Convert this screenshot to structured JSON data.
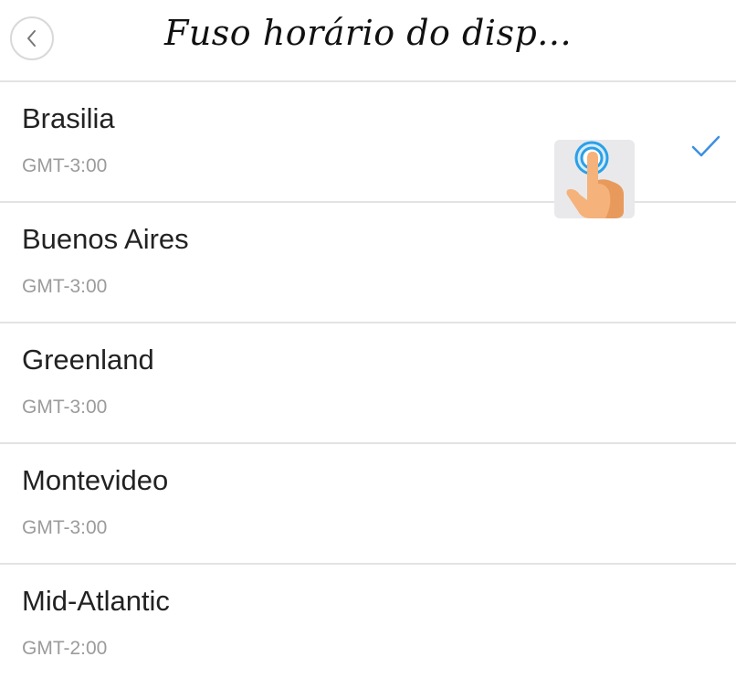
{
  "header": {
    "title": "Fuso horário do disp...",
    "back_icon": "chevron-left-icon"
  },
  "timezones": [
    {
      "name": "Brasilia",
      "offset": "GMT-3:00",
      "selected": true
    },
    {
      "name": "Buenos Aires",
      "offset": "GMT-3:00",
      "selected": false
    },
    {
      "name": "Greenland",
      "offset": "GMT-3:00",
      "selected": false
    },
    {
      "name": "Montevideo",
      "offset": "GMT-3:00",
      "selected": false
    },
    {
      "name": "Mid-Atlantic",
      "offset": "GMT-2:00",
      "selected": false
    }
  ],
  "colors": {
    "accent": "#3d8fe0",
    "divider": "#e3e3e3",
    "secondary_text": "#9b9b9b"
  },
  "overlay": {
    "icon": "tap-gesture-icon"
  }
}
